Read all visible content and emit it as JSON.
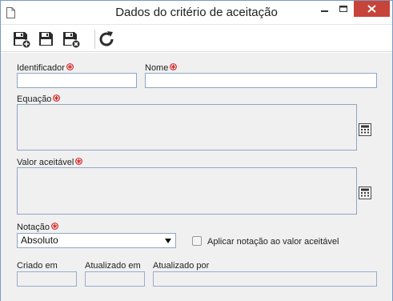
{
  "window": {
    "title": "Dados do critério de aceitação"
  },
  "toolbar": {
    "buttons": [
      {
        "name": "save-new-button",
        "icon": "save-plus-icon"
      },
      {
        "name": "save-button",
        "icon": "save-icon"
      },
      {
        "name": "save-close-button",
        "icon": "save-close-icon"
      },
      {
        "name": "refresh-button",
        "icon": "refresh-icon"
      }
    ]
  },
  "form": {
    "identificador_label": "Identificador",
    "identificador_value": "",
    "nome_label": "Nome",
    "nome_value": "",
    "equacao_label": "Equação",
    "equacao_value": "",
    "valor_label": "Valor aceitável",
    "valor_value": "",
    "notacao_label": "Notação",
    "notacao_value": "Absoluto",
    "aplicar_label": "Aplicar notação ao valor aceitável",
    "aplicar_checked": false,
    "criado_label": "Criado em",
    "atualizado_em_label": "Atualizado em",
    "atualizado_por_label": "Atualizado por"
  },
  "colors": {
    "required_marker": "#d81e1e",
    "close_button": "#c7443a",
    "field_border": "#8fa6c6"
  }
}
